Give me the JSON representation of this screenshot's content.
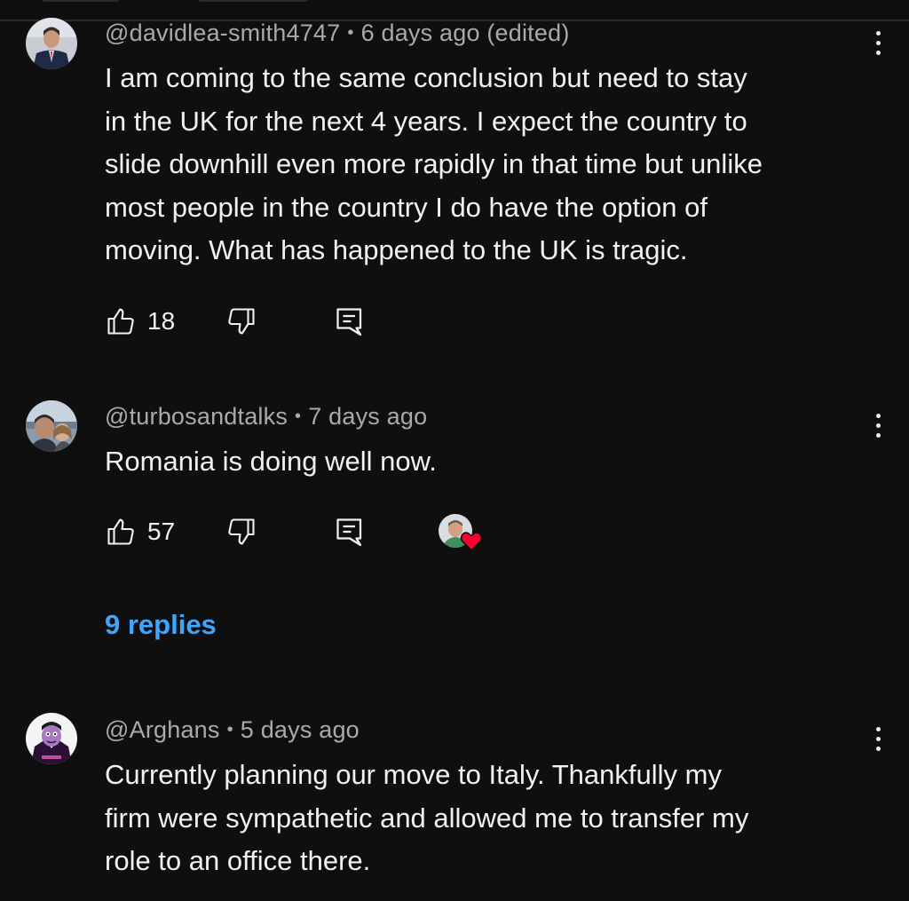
{
  "comments": [
    {
      "handle": "@davidlea-smith4747",
      "separator": "•",
      "time": "6 days ago (edited)",
      "text_lines": [
        "I am coming to the same conclusion but need to stay",
        "in the UK for the next 4 years. I expect the country to",
        "slide downhill even more rapidly in that time but unlike",
        "most people in the country I do have the option of",
        "moving. What has happened to the UK is tragic."
      ],
      "likes": "18"
    },
    {
      "handle": "@turbosandtalks",
      "separator": "•",
      "time": "7 days ago",
      "text_lines": [
        "Romania is doing well now."
      ],
      "likes": "57",
      "replies_label": "9 replies",
      "creator_heart": true
    },
    {
      "handle": "@Arghans",
      "separator": "•",
      "time": "5 days ago",
      "text_lines": [
        "Currently planning our move to Italy. Thankfully my",
        "firm were sympathetic and allowed me to transfer my",
        "role to an office there."
      ]
    }
  ],
  "icons": {
    "like": "thumbs-up-icon",
    "dislike": "thumbs-down-icon",
    "reply": "reply-icon",
    "more": "more-vert-icon",
    "heart": "heart-icon"
  },
  "colors": {
    "background": "#0f0f0f",
    "text": "#f1f1f1",
    "meta": "#aaaaaa",
    "link": "#3ea6ff",
    "heart": "#ff0033"
  }
}
